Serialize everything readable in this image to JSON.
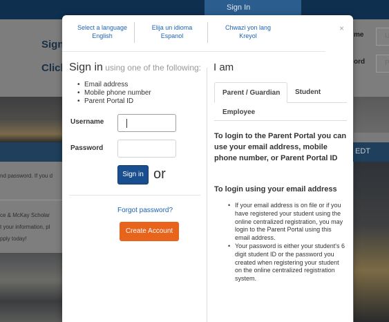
{
  "background": {
    "top_tab": "Sign In",
    "heading_sign": "Sign",
    "heading_click": "Click",
    "label_name": "me",
    "label_word": "ord",
    "input1_hint": "U",
    "input2_hint": "P",
    "timezone": "EDT",
    "text_line1": "nd password. If you d",
    "text_line2": "ce & McKay Scholar",
    "text_line3": "t your information, pl",
    "text_line4": "pply today!"
  },
  "language_selector": {
    "english": {
      "prompt": "Select a language",
      "name": "English"
    },
    "spanish": {
      "prompt": "Elija un idioma",
      "name": "Espanol"
    },
    "kreyol": {
      "prompt": "Chwazi yon lang",
      "name": "Kreyol"
    },
    "close": "×"
  },
  "signin": {
    "heading": "Sign in",
    "heading_suffix": " using one of the following:",
    "options": [
      "Email address",
      "Mobile phone number",
      "Parent Portal ID"
    ],
    "username_label": "Username",
    "password_label": "Password",
    "signin_button": "Sign in",
    "or_text": "or",
    "forgot_link": "Forgot password?",
    "create_account_button": "Create Account"
  },
  "role": {
    "heading": "I am",
    "tabs": [
      "Parent / Guardian",
      "Student",
      "Employee"
    ],
    "active_tab": "Parent / Guardian",
    "info_title": "To login to the Parent Portal you can use your email address, mobile phone number, or Parent Portal ID",
    "info_subtitle": "To login using your email address",
    "bullets": [
      "If your email address is on file or if you have registered your student using the online centralized registration, you may login to the Parent Portal using this email address.",
      "Your password is either your student's 6 digit student ID or the password you created when registering your student on the online centralized registration system."
    ]
  },
  "colors": {
    "link_blue": "#1c63b4",
    "signin_button": "#1a4f8f",
    "create_button": "#e8631b",
    "header_navy": "#0f2f4f"
  }
}
